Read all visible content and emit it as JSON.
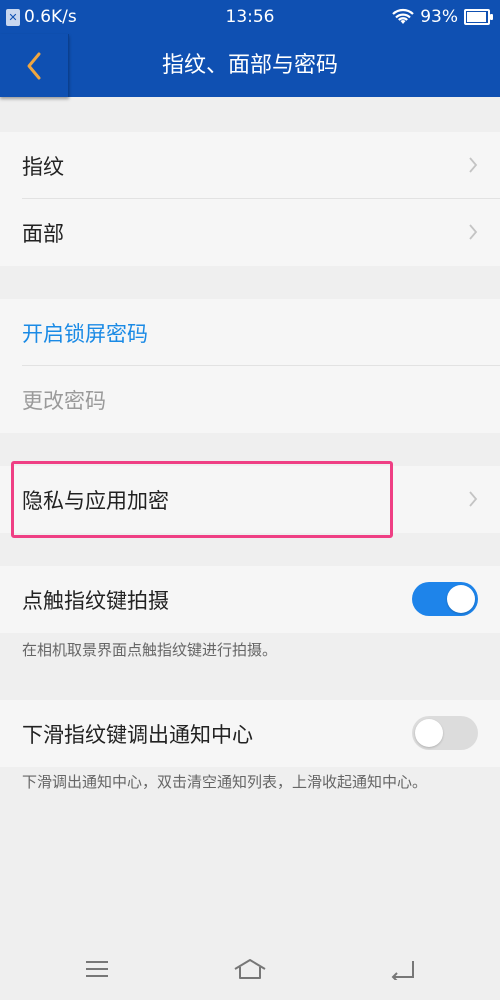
{
  "status": {
    "net_speed": "0.6K/s",
    "time": "13:56",
    "battery": "93%",
    "battery_level": 0.93
  },
  "header": {
    "title": "指纹、面部与密码"
  },
  "group1": {
    "items": [
      {
        "label": "指纹"
      },
      {
        "label": "面部"
      }
    ]
  },
  "group2": {
    "enable_lock_password": "开启锁屏密码",
    "change_password": "更改密码"
  },
  "group3": {
    "privacy_label": "隐私与应用加密"
  },
  "toggles": {
    "tap_capture": {
      "label": "点触指纹键拍摄",
      "state": "on",
      "description": "在相机取景界面点触指纹键进行拍摄。"
    },
    "swipe_notify": {
      "label": "下滑指纹键调出通知中心",
      "state": "off",
      "description": "下滑调出通知中心，双击清空通知列表，上滑收起通知中心。"
    }
  },
  "icons": {
    "back": "chevron-left-icon",
    "chevron": "chevron-right-icon",
    "menu": "menu-icon",
    "home": "home-icon",
    "return": "back-icon"
  },
  "colors": {
    "header_bg": "#0f50b2",
    "accent_blue": "#1a8ae5",
    "toggle_on": "#1e84ea",
    "highlight": "#ef3f84"
  }
}
